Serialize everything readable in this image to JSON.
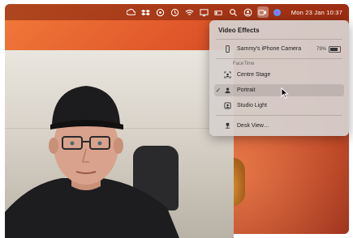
{
  "menubar": {
    "clock": "Mon 23 Jan  10:37",
    "icons": [
      "creative-cloud-icon",
      "dropbox-icon",
      "screen-share-icon",
      "time-machine-icon",
      "wifi-icon",
      "airplay-icon",
      "battery-icon",
      "spotlight-icon",
      "user-icon",
      "video-effects-icon",
      "siri-icon"
    ]
  },
  "panel": {
    "title": "Video Effects",
    "device": "Sammy's iPhone Camera",
    "battery_pct": "79%",
    "battery_level": 0.79,
    "section": "FaceTime",
    "items": [
      {
        "label": "Centre Stage",
        "icon": "centre-stage-icon",
        "checked": ""
      },
      {
        "label": "Portrait",
        "icon": "portrait-icon",
        "checked": "✓"
      },
      {
        "label": "Studio Light",
        "icon": "studio-light-icon",
        "checked": ""
      }
    ],
    "desk_view": "Desk View…"
  }
}
